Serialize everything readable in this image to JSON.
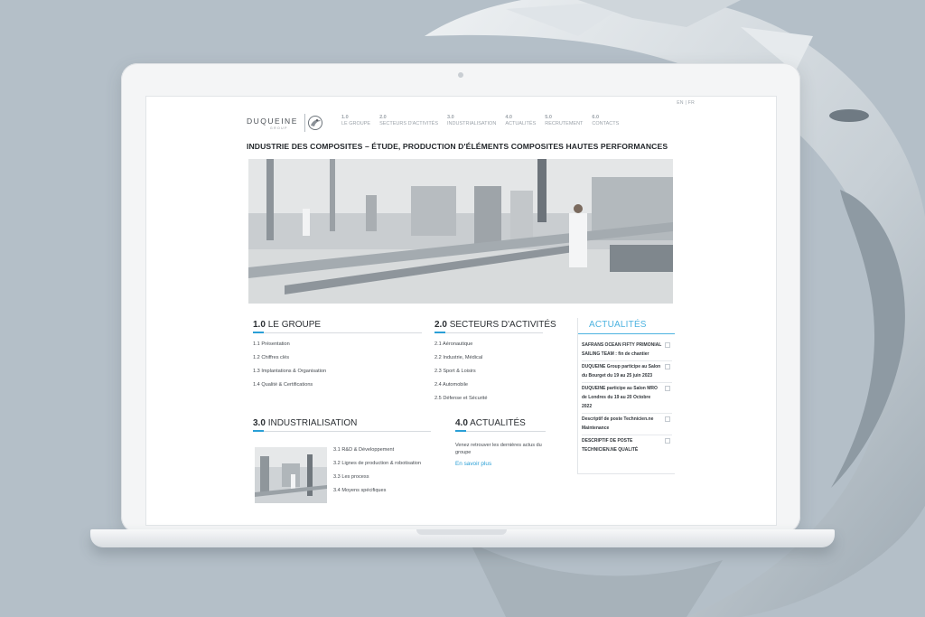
{
  "site": {
    "lang_switch": "EN | FR",
    "logo": {
      "name": "DUQUEINE",
      "subtitle": "GROUP"
    },
    "nav": [
      {
        "num": "1.0",
        "label": "LE GROUPE"
      },
      {
        "num": "2.0",
        "label": "SECTEURS D'ACTIVITÉS"
      },
      {
        "num": "3.0",
        "label": "INDUSTRIALISATION"
      },
      {
        "num": "4.0",
        "label": "ACTUALITÉS"
      },
      {
        "num": "5.0",
        "label": "RECRUTEMENT"
      },
      {
        "num": "6.0",
        "label": "CONTACTS"
      }
    ],
    "hero_title": "INDUSTRIE DES COMPOSITES – ÉTUDE, PRODUCTION D'ÉLÉMENTS COMPOSITES HAUTES PERFORMANCES",
    "sections": {
      "groupe": {
        "num": "1.0",
        "title": "LE GROUPE",
        "links": [
          "1.1 Présentation",
          "1.2 Chiffres clés",
          "1.3 Implantations & Organisation",
          "1.4 Qualité & Certifications"
        ]
      },
      "secteurs": {
        "num": "2.0",
        "title": "SECTEURS D'ACTIVITÉS",
        "links": [
          "2.1 Aéronautique",
          "2.2 Industrie, Médical",
          "2.3 Sport & Loisirs",
          "2.4 Automobile",
          "2.5 Défense et Sécurité"
        ]
      },
      "industrialisation": {
        "num": "3.0",
        "title": "INDUSTRIALISATION",
        "links": [
          "3.1 R&D & Développement",
          "3.2 Lignes de production & robotisation",
          "3.3 Les process",
          "3.4 Moyens spécifiques"
        ]
      },
      "actualites": {
        "num": "4.0",
        "title": "ACTUALITÉS",
        "text": "Venez retrouver les dernières actus du groupe",
        "link": "En savoir plus"
      }
    },
    "news_sidebar": {
      "title": "ACTUALITÉS",
      "items": [
        [
          "SAFRANS OCEAN FIFTY PRIMONIAL",
          "SAILING TEAM : fin de chantier"
        ],
        [
          "DUQUEINE Group participe au Salon",
          "du Bourget du 19 au 25 juin 2023"
        ],
        [
          "DUQUEINE participe au Salon MRO",
          "de Londres du 19 au 20 Octobre",
          "2022"
        ],
        [
          "Descriptif de poste Technicien.ne",
          "Maintenance"
        ],
        [
          "DESCRIPTIF DE POSTE",
          "TECHNICIEN.NE QUALITÉ"
        ]
      ]
    }
  },
  "colors": {
    "accent": "#2a9fd6",
    "news_title": "#4db3e0",
    "background": "#b4bfc8"
  }
}
